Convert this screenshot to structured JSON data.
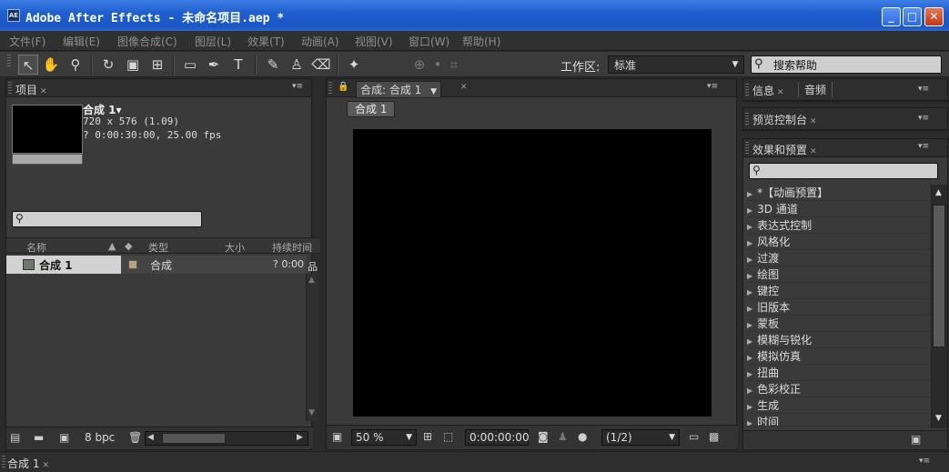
{
  "window": {
    "title": "Adobe After Effects - 未命名项目.aep *",
    "app_icon": "AE",
    "minimize": "_",
    "maximize": "□",
    "close": "✕"
  },
  "menu": [
    "文件(F)",
    "编辑(E)",
    "图像合成(C)",
    "图层(L)",
    "效果(T)",
    "动画(A)",
    "视图(V)",
    "窗口(W)",
    "帮助(H)"
  ],
  "toolbar": {
    "workspace_label": "工作区:",
    "workspace_value": "标准",
    "help_placeholder": "搜索帮助"
  },
  "project": {
    "tab": "项目",
    "comp_name": "合成 1▾",
    "comp_size": "720 x 576 (1.09)",
    "comp_duration": "? 0:00:30:00, 25.00 fps",
    "columns": {
      "name": "名称",
      "type": "类型",
      "size": "大小",
      "duration": "持续时间"
    },
    "rows": [
      {
        "name": "合成 1",
        "type": "合成",
        "duration": "? 0:00"
      }
    ],
    "bpc": "8 bpc"
  },
  "composition": {
    "tab": "合成: 合成 1",
    "breadcrumb": "合成 1",
    "zoom": "50 %",
    "timecode": "0:00:00:00",
    "resolution": "(1/2)"
  },
  "info": {
    "tab1": "信息",
    "tab2": "音频"
  },
  "preview": {
    "tab": "预览控制台"
  },
  "effects": {
    "tab": "效果和预置",
    "items": [
      "*【动画预置】",
      "3D 通道",
      "表达式控制",
      "风格化",
      "过渡",
      "绘图",
      "键控",
      "旧版本",
      "蒙板",
      "模糊与锐化",
      "模拟仿真",
      "扭曲",
      "色彩校正",
      "生成",
      "时间"
    ]
  },
  "timeline": {
    "tab": "合成 1"
  }
}
